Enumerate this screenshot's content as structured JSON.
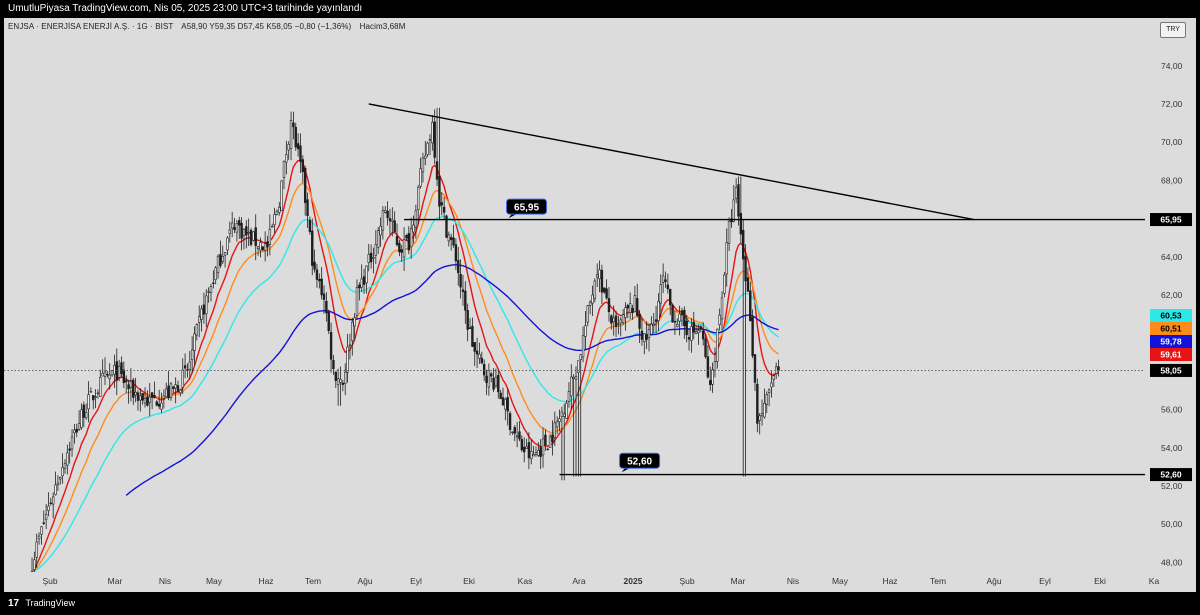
{
  "header": {
    "published": "UmutluPiyasa TradingView.com, Nis 05, 2025 23:00 UTC+3 tarihinde yayınlandı"
  },
  "legend": {
    "symbol": "ENJSA · ENERJİSA ENERJİ A.Ş. · 1G · BIST",
    "ohlc": "A58,90  Y59,35  D57,45  K58,05  −0,80 (−1,36%)",
    "volume": "Hacim3,68M"
  },
  "currency": "TRY",
  "footer": {
    "logo_glyph": "17",
    "brand": "TradingView"
  },
  "colors": {
    "background": "#dcdcdc",
    "up_candle": "#1f1f1f",
    "down_candle": "#1f1f1f",
    "ma_red": "#e61414",
    "ma_orange": "#ff8c1a",
    "ma_cyan": "#2ee8e8",
    "ma_blue": "#1212d8",
    "trendline": "#000000"
  },
  "chart_data": {
    "type": "candlestick",
    "yaxis": {
      "ticks": [
        "48,00",
        "50,00",
        "52,00",
        "54,00",
        "56,00",
        "58,00",
        "60,00",
        "62,00",
        "64,00",
        "66,00",
        "68,00",
        "70,00",
        "72,00",
        "74,00"
      ],
      "tick_values": [
        48,
        50,
        52,
        54,
        56,
        58,
        60,
        62,
        64,
        66,
        68,
        70,
        72,
        74
      ],
      "range": [
        47.5,
        76.5
      ]
    },
    "xaxis": {
      "labels": [
        "Şub",
        "Mar",
        "Nis",
        "May",
        "Haz",
        "Tem",
        "Ağu",
        "Eyl",
        "Eki",
        "Kas",
        "Ara",
        "2025",
        "Şub",
        "Mar",
        "Nis",
        "May",
        "Haz",
        "Tem",
        "Ağu",
        "Eyl",
        "Eki",
        "Ka"
      ],
      "bold": [
        "2025"
      ]
    },
    "price_path": [
      [
        0,
        48.0
      ],
      [
        6,
        50.5
      ],
      [
        14,
        53.5
      ],
      [
        22,
        56.0
      ],
      [
        30,
        57.5
      ],
      [
        36,
        58.0
      ],
      [
        42,
        57.0
      ],
      [
        50,
        56.4
      ],
      [
        60,
        57.0
      ],
      [
        66,
        58.0
      ],
      [
        72,
        61.0
      ],
      [
        80,
        64.0
      ],
      [
        86,
        65.8
      ],
      [
        92,
        65.0
      ],
      [
        100,
        64.5
      ],
      [
        105,
        67.0
      ],
      [
        110,
        71.2
      ],
      [
        115,
        68.0
      ],
      [
        120,
        63.0
      ],
      [
        124,
        62.0
      ],
      [
        128,
        58.0
      ],
      [
        132,
        57.5
      ],
      [
        138,
        62.0
      ],
      [
        144,
        64.0
      ],
      [
        150,
        66.5
      ],
      [
        156,
        64.5
      ],
      [
        160,
        64.8
      ],
      [
        166,
        68.8
      ],
      [
        170,
        71.0
      ],
      [
        173,
        67.0
      ],
      [
        176,
        65.5
      ],
      [
        180,
        64.0
      ],
      [
        184,
        61.0
      ],
      [
        188,
        59.0
      ],
      [
        192,
        58.0
      ],
      [
        196,
        57.5
      ],
      [
        200,
        56.5
      ],
      [
        204,
        55.0
      ],
      [
        208,
        54.0
      ],
      [
        212,
        53.5
      ],
      [
        216,
        54.0
      ],
      [
        220,
        54.5
      ],
      [
        224,
        55.5
      ],
      [
        228,
        57.0
      ],
      [
        232,
        58.5
      ],
      [
        236,
        61.0
      ],
      [
        240,
        63.5
      ],
      [
        244,
        61.5
      ],
      [
        248,
        60.0
      ],
      [
        252,
        61.0
      ],
      [
        256,
        61.5
      ],
      [
        260,
        59.5
      ],
      [
        264,
        60.5
      ],
      [
        268,
        62.8
      ],
      [
        272,
        61.0
      ],
      [
        276,
        60.5
      ],
      [
        280,
        60.0
      ],
      [
        284,
        60.2
      ],
      [
        288,
        57.0
      ],
      [
        292,
        61.0
      ],
      [
        296,
        65.5
      ],
      [
        299,
        67.3
      ],
      [
        302,
        64.0
      ],
      [
        305,
        61.0
      ],
      [
        308,
        55.5
      ],
      [
        311,
        56.0
      ],
      [
        314,
        57.5
      ],
      [
        317,
        58.1
      ]
    ],
    "bars": 318,
    "lows_pinned": [
      [
        [
          130,
          131
        ],
        56.2
      ],
      [
        [
          225,
          226
        ],
        52.3
      ],
      [
        [
          230,
          233
        ],
        52.5
      ],
      [
        [
          302,
          303
        ],
        52.5
      ]
    ],
    "highs_pinned": [
      [
        [
          110,
          111
        ],
        71.6
      ],
      [
        [
          172,
          173
        ],
        71.8
      ],
      [
        [
          300,
          301
        ],
        68.2
      ]
    ],
    "moving_averages": [
      {
        "color": "#e61414",
        "window": 10,
        "last_value": "59,61"
      },
      {
        "color": "#ff8c1a",
        "window": 20,
        "last_value": "60,51"
      },
      {
        "color": "#2ee8e8",
        "window": 40,
        "last_value": "60,53"
      },
      {
        "color": "#1212d8",
        "window": 110,
        "last_value": "59,78"
      }
    ],
    "last_close": "58,05",
    "last_close_value": 58.05,
    "levels": [
      {
        "value": 65.95,
        "label": "65,95",
        "from_bar": 158
      },
      {
        "value": 52.6,
        "label": "52,60",
        "from_bar": 224
      }
    ],
    "trendline": {
      "from": [
        143,
        72.0
      ],
      "to": [
        400,
        65.95
      ]
    },
    "callouts": [
      {
        "label": "65,95",
        "bar": 210,
        "value": 66.6
      },
      {
        "label": "52,60",
        "bar": 258,
        "value": 53.3
      }
    ]
  }
}
